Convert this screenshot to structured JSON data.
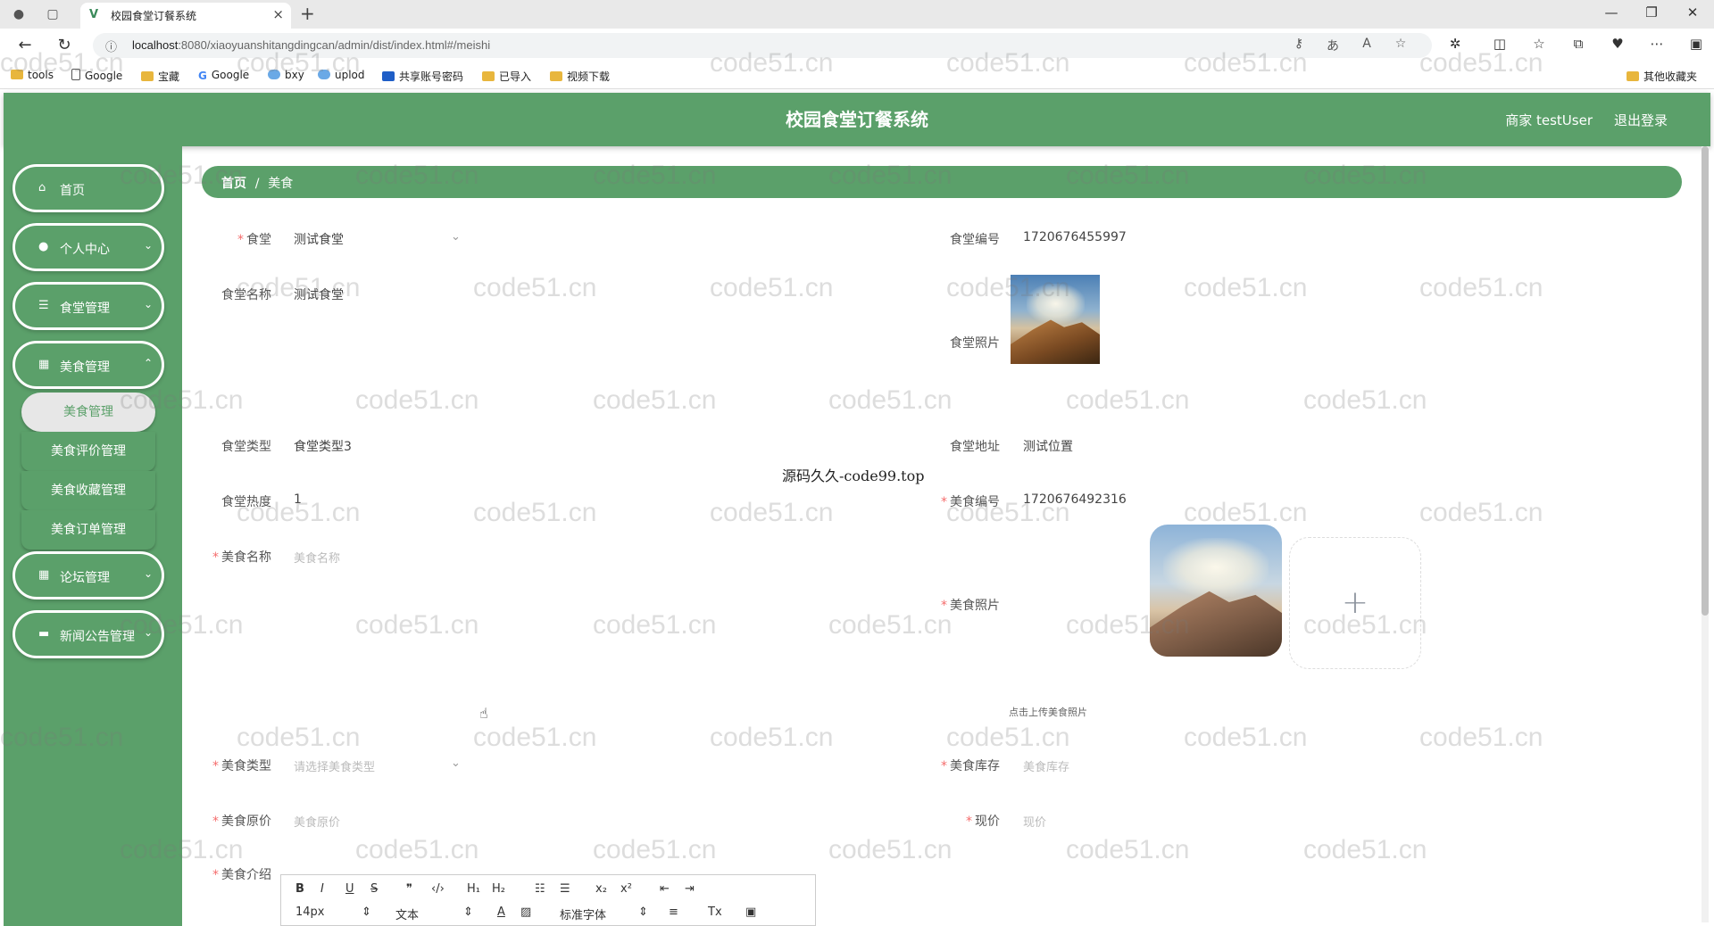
{
  "browser": {
    "tab_title": "校园食堂订餐系统",
    "url_host": "localhost",
    "url_rest": ":8080/xiaoyuanshitangdingcan/admin/dist/index.html#/meishi",
    "bookmarks": [
      "tools",
      "Google",
      "宝藏",
      "Google",
      "bxy",
      "uplod",
      "共享账号密码",
      "已导入",
      "视频下载"
    ],
    "bookmarks_other": "其他收藏夹"
  },
  "header": {
    "title": "校园食堂订餐系统",
    "user": "商家 testUser",
    "logout": "退出登录"
  },
  "sidebar": {
    "items": [
      {
        "label": "首页"
      },
      {
        "label": "个人中心"
      },
      {
        "label": "食堂管理"
      },
      {
        "label": "美食管理"
      },
      {
        "label": "论坛管理"
      },
      {
        "label": "新闻公告管理"
      }
    ],
    "submenu": [
      "美食管理",
      "美食评价管理",
      "美食收藏管理",
      "美食订单管理"
    ]
  },
  "breadcrumb": {
    "home": "首页",
    "sep": "/",
    "current": "美食"
  },
  "form": {
    "canteen_label": "食堂",
    "canteen_value": "测试食堂",
    "canteen_no_label": "食堂编号",
    "canteen_no_value": "1720676455997",
    "canteen_name_label": "食堂名称",
    "canteen_name_value": "测试食堂",
    "canteen_photo_label": "食堂照片",
    "canteen_type_label": "食堂类型",
    "canteen_type_value": "食堂类型3",
    "canteen_addr_label": "食堂地址",
    "canteen_addr_value": "测试位置",
    "canteen_heat_label": "食堂热度",
    "canteen_heat_value": "1",
    "food_no_label": "美食编号",
    "food_no_value": "1720676492316",
    "food_name_label": "美食名称",
    "food_name_ph": "美食名称",
    "food_photo_label": "美食照片",
    "upload_tip": "点击上传美食照片",
    "food_type_label": "美食类型",
    "food_type_ph": "请选择美食类型",
    "food_stock_label": "美食库存",
    "food_stock_ph": "美食库存",
    "orig_price_label": "美食原价",
    "orig_price_ph": "美食原价",
    "price_label": "现价",
    "price_ph": "现价",
    "intro_label": "美食介绍"
  },
  "editor": {
    "font_size": "14px",
    "block_type": "文本",
    "font_family": "标准字体"
  },
  "watermark": {
    "text": "code51.cn",
    "center_text": "源码久久-code99.top"
  }
}
